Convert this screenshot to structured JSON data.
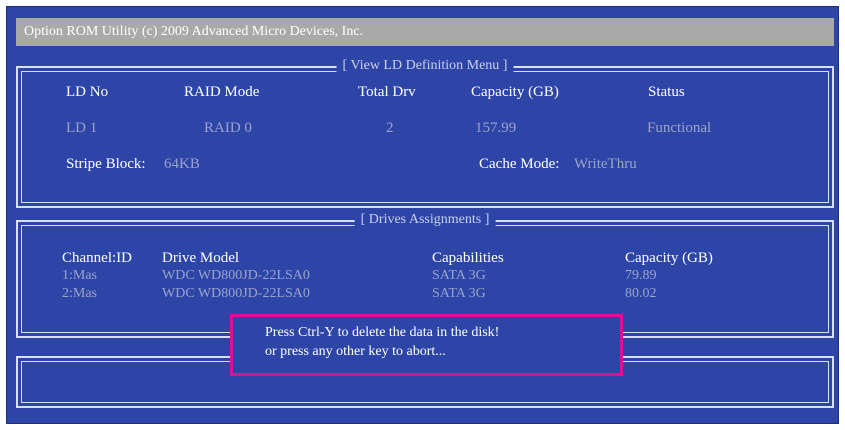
{
  "title": "Option ROM Utility (c) 2009 Advanced Micro Devices, Inc.",
  "ld_panel": {
    "legend": "[ View LD Definition Menu ]",
    "headers": {
      "ld_no": "LD  No",
      "raid_mode": "RAID Mode",
      "total_drv": "Total Drv",
      "capacity": "Capacity (GB)",
      "status": "Status"
    },
    "row": {
      "ld_no": "LD  1",
      "raid_mode": "RAID 0",
      "total_drv": "2",
      "capacity": "157.99",
      "status": "Functional"
    },
    "stripe_label": "Stripe Block:",
    "stripe_value": "64KB",
    "cache_label": "Cache Mode:",
    "cache_value": "WriteThru"
  },
  "drives_panel": {
    "legend": "[ Drives Assignments ]",
    "headers": {
      "channel": "Channel:ID",
      "model": "Drive Model",
      "capabilities": "Capabilities",
      "capacity": "Capacity (GB)"
    },
    "rows": [
      {
        "channel": "1:Mas",
        "model": "WDC WD800JD-22LSA0",
        "capabilities": "SATA 3G",
        "capacity": "79.89"
      },
      {
        "channel": "2:Mas",
        "model": "WDC WD800JD-22LSA0",
        "capabilities": "SATA 3G",
        "capacity": "80.02"
      }
    ]
  },
  "dialog": {
    "line1": "Press Ctrl-Y to delete the data in the disk!",
    "line2": "or press any other key to abort..."
  },
  "colors": {
    "background": "#2e45a8",
    "highlight_border": "#e0118f",
    "titlebar": "#a9a9a9"
  }
}
